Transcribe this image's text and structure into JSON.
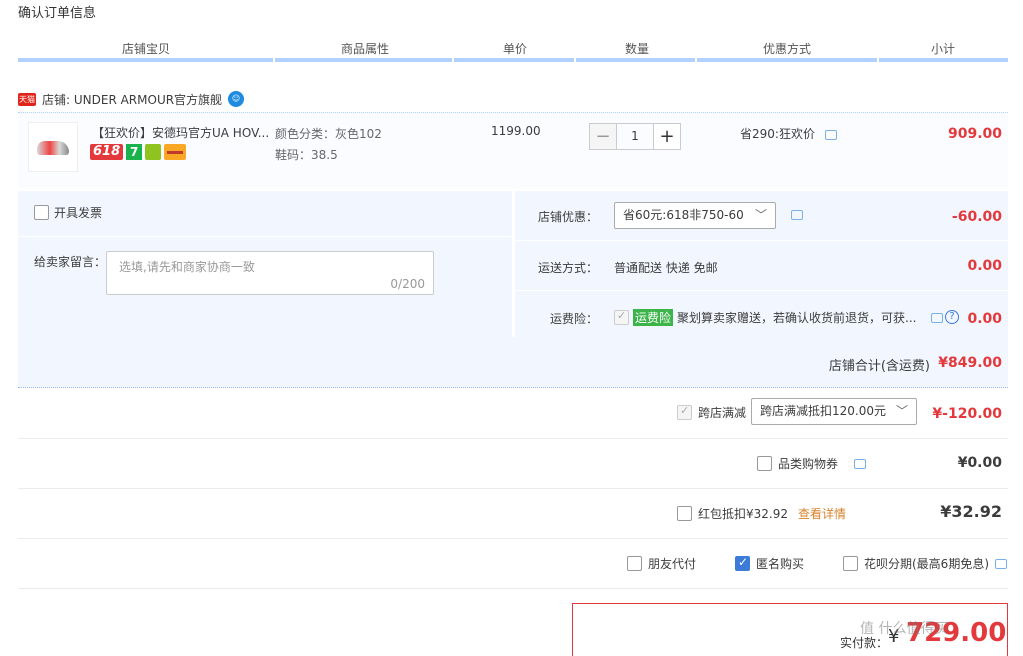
{
  "page_title": "确认订单信息",
  "columns": [
    "店铺宝贝",
    "商品属性",
    "单价",
    "数量",
    "优惠方式",
    "小计"
  ],
  "shop": {
    "logo_text": "天猫",
    "label": "店铺: UNDER ARMOUR官方旗舰",
    "ww_icon": "wangwang-chat-icon"
  },
  "item": {
    "quote": "''",
    "name": "【狂欢价】安德玛官方UA HOV...",
    "badges": {
      "b618": "618",
      "b7": "7"
    },
    "attr_color": "颜色分类：灰色102",
    "attr_size": "鞋码：38.5",
    "unit_price": "1199.00",
    "qty_minus": "−",
    "qty_value": "1",
    "qty_plus": "+",
    "promo": "省290:狂欢价",
    "subtotal": "909.00"
  },
  "options": {
    "invoice_label": "开具发票",
    "message_label": "给卖家留言：",
    "message_placeholder": "选填,请先和商家协商一致",
    "message_count": "0/200",
    "shop_discount_label": "店铺优惠：",
    "shop_discount_value": "省60元:618非750-60",
    "shop_discount_amount": "-60.00",
    "shipping_label": "运送方式：",
    "shipping_value": "普通配送 快递 免邮",
    "shipping_amount": "0.00",
    "insurance_label": "运费险：",
    "insurance_tag": "运费险",
    "insurance_text": "聚划算卖家赠送，若确认收货前退货，可获...",
    "insurance_amount": "0.00"
  },
  "shop_total": {
    "label": "店铺合计(含运费)",
    "amount": "¥849.00"
  },
  "cross_store": {
    "label": "跨店满减",
    "select": "跨店满减抵扣120.00元",
    "amount": "¥-120.00"
  },
  "category_coupon": {
    "label": "品类购物券",
    "amount": "¥0.00"
  },
  "red_packet": {
    "label": "红包抵扣¥32.92",
    "link": "查看详情",
    "amount": "¥32.92"
  },
  "pay_options": {
    "friend": "朋友代付",
    "anonymous": "匿名购买",
    "huabei": "花呗分期(最高6期免息)"
  },
  "final": {
    "label": "实付款：",
    "currency": "¥",
    "amount": "729.00"
  },
  "watermark": "值 什么值得买"
}
